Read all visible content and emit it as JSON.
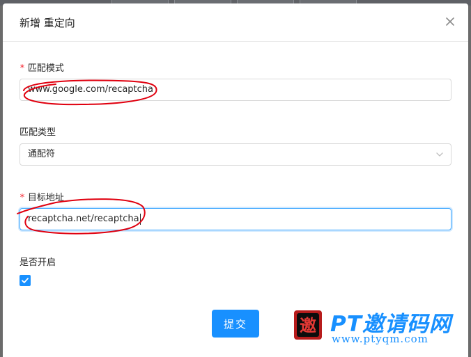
{
  "dialog": {
    "title": "新增 重定向"
  },
  "form": {
    "match_pattern": {
      "required_mark": "*",
      "label": "匹配模式",
      "value": "www.google.com/recaptcha"
    },
    "match_type": {
      "label": "匹配类型",
      "selected": "通配符"
    },
    "target_address": {
      "required_mark": "*",
      "label": "目标地址",
      "value": "recaptcha.net/recaptcha"
    },
    "enabled": {
      "label": "是否开启",
      "checked": true
    },
    "submit_label": "提交"
  },
  "icons": {
    "close": "close-icon",
    "select_arrow": "chevron-down-icon",
    "checkbox_check": "check-icon"
  },
  "watermark": {
    "seal_char": "邀",
    "text": "PT邀请码网",
    "url": "www.ptyqm.com"
  },
  "colors": {
    "primary": "#1890ff",
    "required": "#f5222d",
    "annotation": "#e0000f"
  }
}
